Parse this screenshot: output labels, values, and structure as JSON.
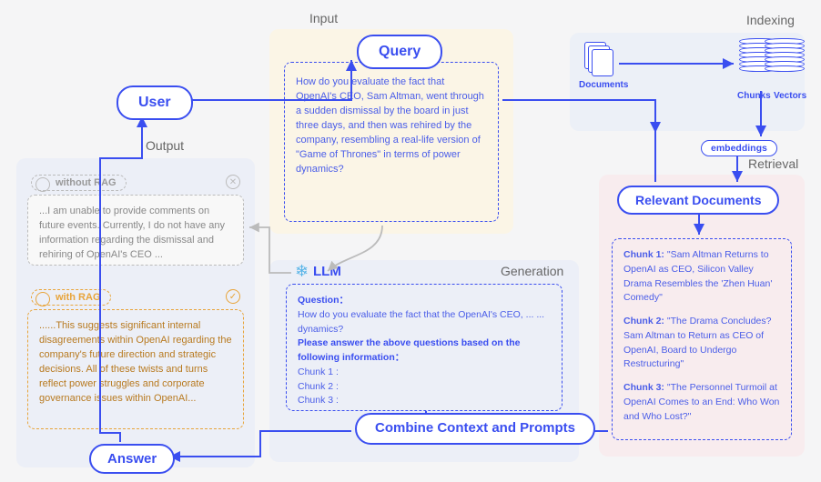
{
  "sections": {
    "output": "Output",
    "input": "Input",
    "indexing": "Indexing",
    "retrieval": "Retrieval",
    "generation": "Generation"
  },
  "nodes": {
    "user": "User",
    "query": "Query",
    "answer": "Answer",
    "combine": "Combine Context and Prompts",
    "llm": "LLM",
    "relevant_docs": "Relevant Documents",
    "embeddings": "embeddings",
    "documents": "Documents",
    "chunks": "Chunks",
    "vectors": "Vectors"
  },
  "query_text": "How do you evaluate the fact that OpenAI's CEO, Sam Altman, went through a sudden dismissal by the board in just three days, and then was rehired by the company, resembling a real-life version of \"Game of Thrones\" in terms of power dynamics?",
  "without_rag": {
    "tag": "without RAG",
    "text": "...I am unable to provide comments on future events. Currently, I do not have any information regarding the dismissal and rehiring of OpenAI's CEO ..."
  },
  "with_rag": {
    "tag": "with RAG",
    "text": "......This suggests significant internal disagreements within OpenAI regarding the company's future direction and strategic decisions. All of these twists and turns reflect power struggles and corporate governance issues within OpenAI..."
  },
  "generation_prompt": {
    "question_label": "Question：",
    "question_text": "How do you evaluate the fact that the OpenAI's CEO, ... ... dynamics?",
    "instruction": "Please answer the above questions based on the following information：",
    "lines": [
      "Chunk 1 :",
      "Chunk 2 :",
      "Chunk 3 :"
    ]
  },
  "chunks": [
    {
      "label": "Chunk 1:",
      "text": "\"Sam Altman Returns to OpenAI as CEO, Silicon Valley Drama Resembles the 'Zhen Huan' Comedy\""
    },
    {
      "label": "Chunk 2:",
      "text": "\"The Drama Concludes? Sam Altman to Return as CEO of OpenAI, Board to Undergo Restructuring\""
    },
    {
      "label": "Chunk 3:",
      "text": "\"The Personnel Turmoil at OpenAI Comes to an End: Who Won and Who Lost?\""
    }
  ]
}
